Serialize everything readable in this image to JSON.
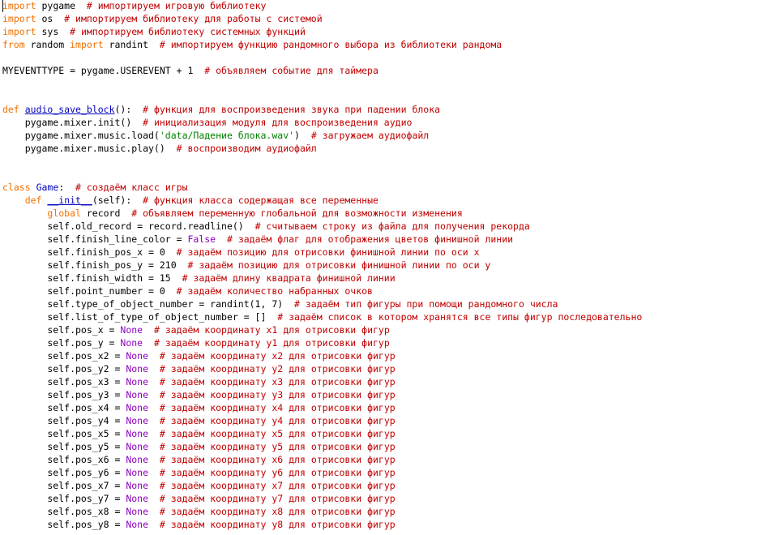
{
  "colors": {
    "background": "#ffffff",
    "keyword": "#f07000",
    "function_name": "#0000c0",
    "string": "#008000",
    "comment": "#c00000",
    "constant": "#9000c0",
    "text": "#000000"
  },
  "lines": [
    [
      [
        "kw",
        "import"
      ],
      [
        "text",
        " pygame  "
      ],
      [
        "comment",
        "# импортируем игровую библиотеку"
      ]
    ],
    [
      [
        "kw",
        "import"
      ],
      [
        "text",
        " os  "
      ],
      [
        "comment",
        "# импортируем библиотеку для работы с системой"
      ]
    ],
    [
      [
        "kw",
        "import"
      ],
      [
        "text",
        " sys  "
      ],
      [
        "comment",
        "# импортируем библиотеку системных функций"
      ]
    ],
    [
      [
        "kw",
        "from"
      ],
      [
        "text",
        " random "
      ],
      [
        "kw",
        "import"
      ],
      [
        "text",
        " randint  "
      ],
      [
        "comment",
        "# импортируем функцию рандомного выбора из библиотеки рандома"
      ]
    ],
    [],
    [
      [
        "text",
        "MYEVENTTYPE = pygame.USEREVENT + 1  "
      ],
      [
        "comment",
        "# объявляем событие для таймера"
      ]
    ],
    [],
    [],
    [
      [
        "kw",
        "def"
      ],
      [
        "text",
        " "
      ],
      [
        "func",
        "audio_save_block"
      ],
      [
        "text",
        "():  "
      ],
      [
        "comment",
        "# функция для воспроизведения звука при падении блока"
      ]
    ],
    [
      [
        "text",
        "    pygame.mixer.init()  "
      ],
      [
        "comment",
        "# инициализация модуля для воспроизведения аудио"
      ]
    ],
    [
      [
        "text",
        "    pygame.mixer.music.load("
      ],
      [
        "str",
        "'data/Падение блока.wav'"
      ],
      [
        "text",
        ")  "
      ],
      [
        "comment",
        "# загружаем аудиофайл"
      ]
    ],
    [
      [
        "text",
        "    pygame.mixer.music.play()  "
      ],
      [
        "comment",
        "# воспроизводим аудиофайл"
      ]
    ],
    [],
    [],
    [
      [
        "kw",
        "class"
      ],
      [
        "text",
        " "
      ],
      [
        "cls",
        "Game"
      ],
      [
        "text",
        ":  "
      ],
      [
        "comment",
        "# создаём класс игры"
      ]
    ],
    [
      [
        "text",
        "    "
      ],
      [
        "kw",
        "def"
      ],
      [
        "text",
        " "
      ],
      [
        "func",
        "__init__"
      ],
      [
        "text",
        "(self):  "
      ],
      [
        "comment",
        "# функция класса содержащая все переменные"
      ]
    ],
    [
      [
        "text",
        "        "
      ],
      [
        "kw",
        "global"
      ],
      [
        "text",
        " record  "
      ],
      [
        "comment",
        "# объявляем переменную глобальной для возможности изменения"
      ]
    ],
    [
      [
        "text",
        "        self.old_record = record.readline()  "
      ],
      [
        "comment",
        "# считываем строку из файла для получения рекорда"
      ]
    ],
    [
      [
        "text",
        "        self.finish_line_color = "
      ],
      [
        "const",
        "False"
      ],
      [
        "text",
        "  "
      ],
      [
        "comment",
        "# задаём флаг для отображения цветов финишной линии"
      ]
    ],
    [
      [
        "text",
        "        self.finish_pos_x = 0  "
      ],
      [
        "comment",
        "# задаём позицию для отрисовки финишной линии по оси x"
      ]
    ],
    [
      [
        "text",
        "        self.finish_pos_y = 210  "
      ],
      [
        "comment",
        "# задаём позицию для отрисовки финишной линии по оси y"
      ]
    ],
    [
      [
        "text",
        "        self.finish_width = 15  "
      ],
      [
        "comment",
        "# задаём длину квадрата финишной линии"
      ]
    ],
    [
      [
        "text",
        "        self.point_number = 0  "
      ],
      [
        "comment",
        "# задаём количество набранных очков"
      ]
    ],
    [
      [
        "text",
        "        self.type_of_object_number = randint(1, 7)  "
      ],
      [
        "comment",
        "# задаём тип фигуры при помощи рандомного числа"
      ]
    ],
    [
      [
        "text",
        "        self.list_of_type_of_object_number = []  "
      ],
      [
        "comment",
        "# задаём список в котором хранятся все типы фигур последовательно"
      ]
    ],
    [
      [
        "text",
        "        self.pos_x = "
      ],
      [
        "const",
        "None"
      ],
      [
        "text",
        "  "
      ],
      [
        "comment",
        "# задаём координату x1 для отрисовки фигур"
      ]
    ],
    [
      [
        "text",
        "        self.pos_y = "
      ],
      [
        "const",
        "None"
      ],
      [
        "text",
        "  "
      ],
      [
        "comment",
        "# задаём координату y1 для отрисовки фигур"
      ]
    ],
    [
      [
        "text",
        "        self.pos_x2 = "
      ],
      [
        "const",
        "None"
      ],
      [
        "text",
        "  "
      ],
      [
        "comment",
        "# задаём координату x2 для отрисовки фигур"
      ]
    ],
    [
      [
        "text",
        "        self.pos_y2 = "
      ],
      [
        "const",
        "None"
      ],
      [
        "text",
        "  "
      ],
      [
        "comment",
        "# задаём координату y2 для отрисовки фигур"
      ]
    ],
    [
      [
        "text",
        "        self.pos_x3 = "
      ],
      [
        "const",
        "None"
      ],
      [
        "text",
        "  "
      ],
      [
        "comment",
        "# задаём координату x3 для отрисовки фигур"
      ]
    ],
    [
      [
        "text",
        "        self.pos_y3 = "
      ],
      [
        "const",
        "None"
      ],
      [
        "text",
        "  "
      ],
      [
        "comment",
        "# задаём координату y3 для отрисовки фигур"
      ]
    ],
    [
      [
        "text",
        "        self.pos_x4 = "
      ],
      [
        "const",
        "None"
      ],
      [
        "text",
        "  "
      ],
      [
        "comment",
        "# задаём координату x4 для отрисовки фигур"
      ]
    ],
    [
      [
        "text",
        "        self.pos_y4 = "
      ],
      [
        "const",
        "None"
      ],
      [
        "text",
        "  "
      ],
      [
        "comment",
        "# задаём координату y4 для отрисовки фигур"
      ]
    ],
    [
      [
        "text",
        "        self.pos_x5 = "
      ],
      [
        "const",
        "None"
      ],
      [
        "text",
        "  "
      ],
      [
        "comment",
        "# задаём координату x5 для отрисовки фигур"
      ]
    ],
    [
      [
        "text",
        "        self.pos_y5 = "
      ],
      [
        "const",
        "None"
      ],
      [
        "text",
        "  "
      ],
      [
        "comment",
        "# задаём координату y5 для отрисовки фигур"
      ]
    ],
    [
      [
        "text",
        "        self.pos_x6 = "
      ],
      [
        "const",
        "None"
      ],
      [
        "text",
        "  "
      ],
      [
        "comment",
        "# задаём координату x6 для отрисовки фигур"
      ]
    ],
    [
      [
        "text",
        "        self.pos_y6 = "
      ],
      [
        "const",
        "None"
      ],
      [
        "text",
        "  "
      ],
      [
        "comment",
        "# задаём координату y6 для отрисовки фигур"
      ]
    ],
    [
      [
        "text",
        "        self.pos_x7 = "
      ],
      [
        "const",
        "None"
      ],
      [
        "text",
        "  "
      ],
      [
        "comment",
        "# задаём координату x7 для отрисовки фигур"
      ]
    ],
    [
      [
        "text",
        "        self.pos_y7 = "
      ],
      [
        "const",
        "None"
      ],
      [
        "text",
        "  "
      ],
      [
        "comment",
        "# задаём координату y7 для отрисовки фигур"
      ]
    ],
    [
      [
        "text",
        "        self.pos_x8 = "
      ],
      [
        "const",
        "None"
      ],
      [
        "text",
        "  "
      ],
      [
        "comment",
        "# задаём координату x8 для отрисовки фигур"
      ]
    ],
    [
      [
        "text",
        "        self.pos_y8 = "
      ],
      [
        "const",
        "None"
      ],
      [
        "text",
        "  "
      ],
      [
        "comment",
        "# задаём координату y8 для отрисовки фигур"
      ]
    ]
  ]
}
